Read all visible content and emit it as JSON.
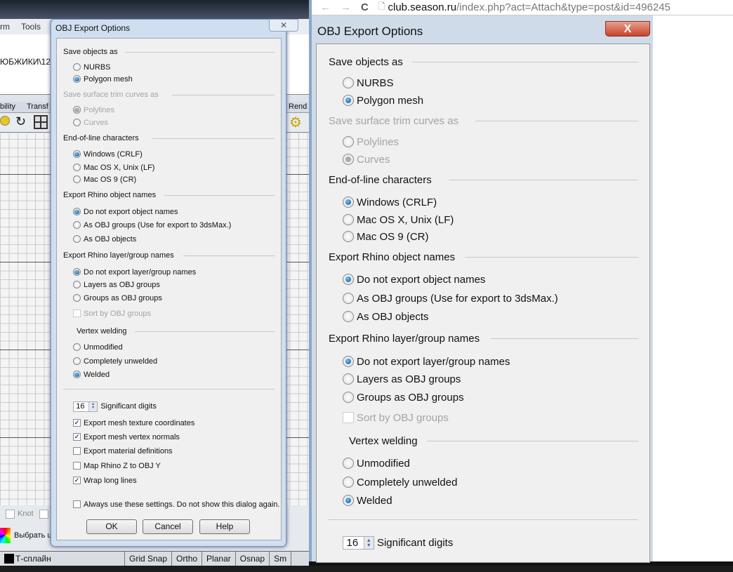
{
  "rhino": {
    "menu": [
      "rm",
      "Tools"
    ],
    "command_text": "ЮБЖИКИ\\12",
    "tabs": [
      "bility",
      "Transf"
    ],
    "right_tab": "Rend",
    "osnap_label": "Knot",
    "color_button": "Выбрать ц",
    "status": {
      "layer": "Т-сплайн",
      "items": [
        "Grid Snap",
        "Ortho",
        "Planar",
        "Osnap",
        "Sm"
      ]
    }
  },
  "browser": {
    "url_domain": "club.season.ru",
    "url_path": "/index.php?act=Attach&type=post&id=496245",
    "back": "←",
    "forward": "→",
    "reload": "C"
  },
  "dialog_left": {
    "title": "OBJ Export Options",
    "close": "✕",
    "items": [
      {
        "type": "header",
        "label": "Save objects as"
      },
      {
        "type": "radio",
        "label": "NURBS",
        "checked": false
      },
      {
        "type": "radio",
        "label": "Polygon mesh",
        "checked": true
      },
      {
        "type": "header",
        "label": "Save surface trim curves as",
        "disabled": true
      },
      {
        "type": "radio",
        "label": "Polylines",
        "checked": true,
        "disabled": true
      },
      {
        "type": "radio",
        "label": "Curves",
        "checked": false,
        "disabled": true
      },
      {
        "type": "header",
        "label": "End-of-line characters"
      },
      {
        "type": "radio",
        "label": "Windows (CRLF)",
        "checked": true
      },
      {
        "type": "radio",
        "label": "Mac OS X, Unix (LF)",
        "checked": false
      },
      {
        "type": "radio",
        "label": "Mac OS 9 (CR)",
        "checked": false
      },
      {
        "type": "header",
        "label": "Export Rhino object names"
      },
      {
        "type": "radio",
        "label": "Do not export object names",
        "checked": true
      },
      {
        "type": "radio",
        "label": "As OBJ groups  (Use for export to 3dsMax.)",
        "checked": false
      },
      {
        "type": "radio",
        "label": "As OBJ objects",
        "checked": false
      },
      {
        "type": "header",
        "label": "Export Rhino layer/group names"
      },
      {
        "type": "radio",
        "label": "Do not export layer/group names",
        "checked": true
      },
      {
        "type": "radio",
        "label": "Layers as OBJ groups",
        "checked": false
      },
      {
        "type": "radio",
        "label": "Groups as OBJ groups",
        "checked": false
      },
      {
        "type": "check",
        "label": "Sort by OBJ groups",
        "checked": false,
        "disabled": true
      },
      {
        "type": "header",
        "label": "Vertex welding",
        "indent": true
      },
      {
        "type": "radio",
        "label": "Unmodified",
        "checked": false
      },
      {
        "type": "radio",
        "label": "Completely unwelded",
        "checked": false
      },
      {
        "type": "radio",
        "label": "Welded",
        "checked": true
      },
      {
        "type": "sep"
      },
      {
        "type": "spin",
        "value": "16",
        "label": "Significant digits"
      },
      {
        "type": "check",
        "label": "Export mesh texture coordinates",
        "checked": true
      },
      {
        "type": "check",
        "label": "Export mesh vertex normals",
        "checked": true
      },
      {
        "type": "check",
        "label": "Export material definitions",
        "checked": false
      },
      {
        "type": "check",
        "label": "Map Rhino Z to OBJ Y",
        "checked": false
      },
      {
        "type": "check",
        "label": "Wrap long lines",
        "checked": true
      },
      {
        "type": "check",
        "label": "Always use these settings. Do not show this dialog again.",
        "checked": false
      }
    ],
    "buttons": [
      "OK",
      "Cancel",
      "Help"
    ]
  },
  "dialog_right": {
    "title": "OBJ Export Options",
    "close": "X",
    "items": [
      {
        "type": "header",
        "label": "Save objects as"
      },
      {
        "type": "radio",
        "label": "NURBS",
        "checked": false
      },
      {
        "type": "radio",
        "label": "Polygon mesh",
        "checked": true
      },
      {
        "type": "header",
        "label": "Save surface trim curves as",
        "disabled": true
      },
      {
        "type": "radio",
        "label": "Polylines",
        "checked": false,
        "disabled": true
      },
      {
        "type": "radio",
        "label": "Curves",
        "checked": true,
        "disabled": true
      },
      {
        "type": "header",
        "label": "End-of-line characters"
      },
      {
        "type": "radio",
        "label": "Windows (CRLF)",
        "checked": true
      },
      {
        "type": "radio",
        "label": "Mac OS X, Unix (LF)",
        "checked": false
      },
      {
        "type": "radio",
        "label": "Mac OS 9 (CR)",
        "checked": false
      },
      {
        "type": "header",
        "label": "Export Rhino object names"
      },
      {
        "type": "radio",
        "label": "Do not export object names",
        "checked": true
      },
      {
        "type": "radio",
        "label": "As OBJ groups  (Use for export to 3dsMax.)",
        "checked": false
      },
      {
        "type": "radio",
        "label": "As OBJ objects",
        "checked": false
      },
      {
        "type": "header",
        "label": "Export Rhino layer/group names"
      },
      {
        "type": "radio",
        "label": "Do not export layer/group names",
        "checked": true
      },
      {
        "type": "radio",
        "label": "Layers as OBJ groups",
        "checked": false
      },
      {
        "type": "radio",
        "label": "Groups as OBJ groups",
        "checked": false
      },
      {
        "type": "check",
        "label": "Sort by OBJ groups",
        "checked": false,
        "disabled": true
      },
      {
        "type": "header",
        "label": "Vertex welding",
        "indent": true
      },
      {
        "type": "radio",
        "label": "Unmodified",
        "checked": false
      },
      {
        "type": "radio",
        "label": "Completely unwelded",
        "checked": false
      },
      {
        "type": "radio",
        "label": "Welded",
        "checked": true
      },
      {
        "type": "sep"
      },
      {
        "type": "spin",
        "value": "16",
        "label": "Significant digits"
      }
    ]
  }
}
